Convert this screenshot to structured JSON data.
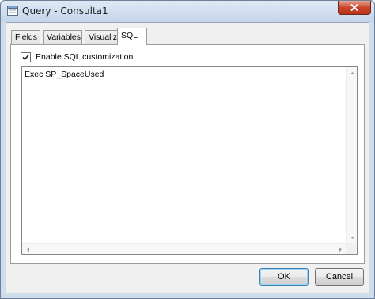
{
  "window": {
    "title": "Query - Consulta1"
  },
  "tabs": [
    {
      "label": "Fields",
      "active": false
    },
    {
      "label": "Variables",
      "active": false
    },
    {
      "label": "Visualize",
      "active": false
    },
    {
      "label": "SQL",
      "active": true
    }
  ],
  "sql_tab": {
    "enable_label": "Enable SQL customization",
    "enable_checked": true,
    "sql_text": "Exec SP_SpaceUsed"
  },
  "buttons": {
    "ok": "OK",
    "cancel": "Cancel"
  },
  "icons": {
    "title": "query-window-icon",
    "close": "close-icon"
  }
}
